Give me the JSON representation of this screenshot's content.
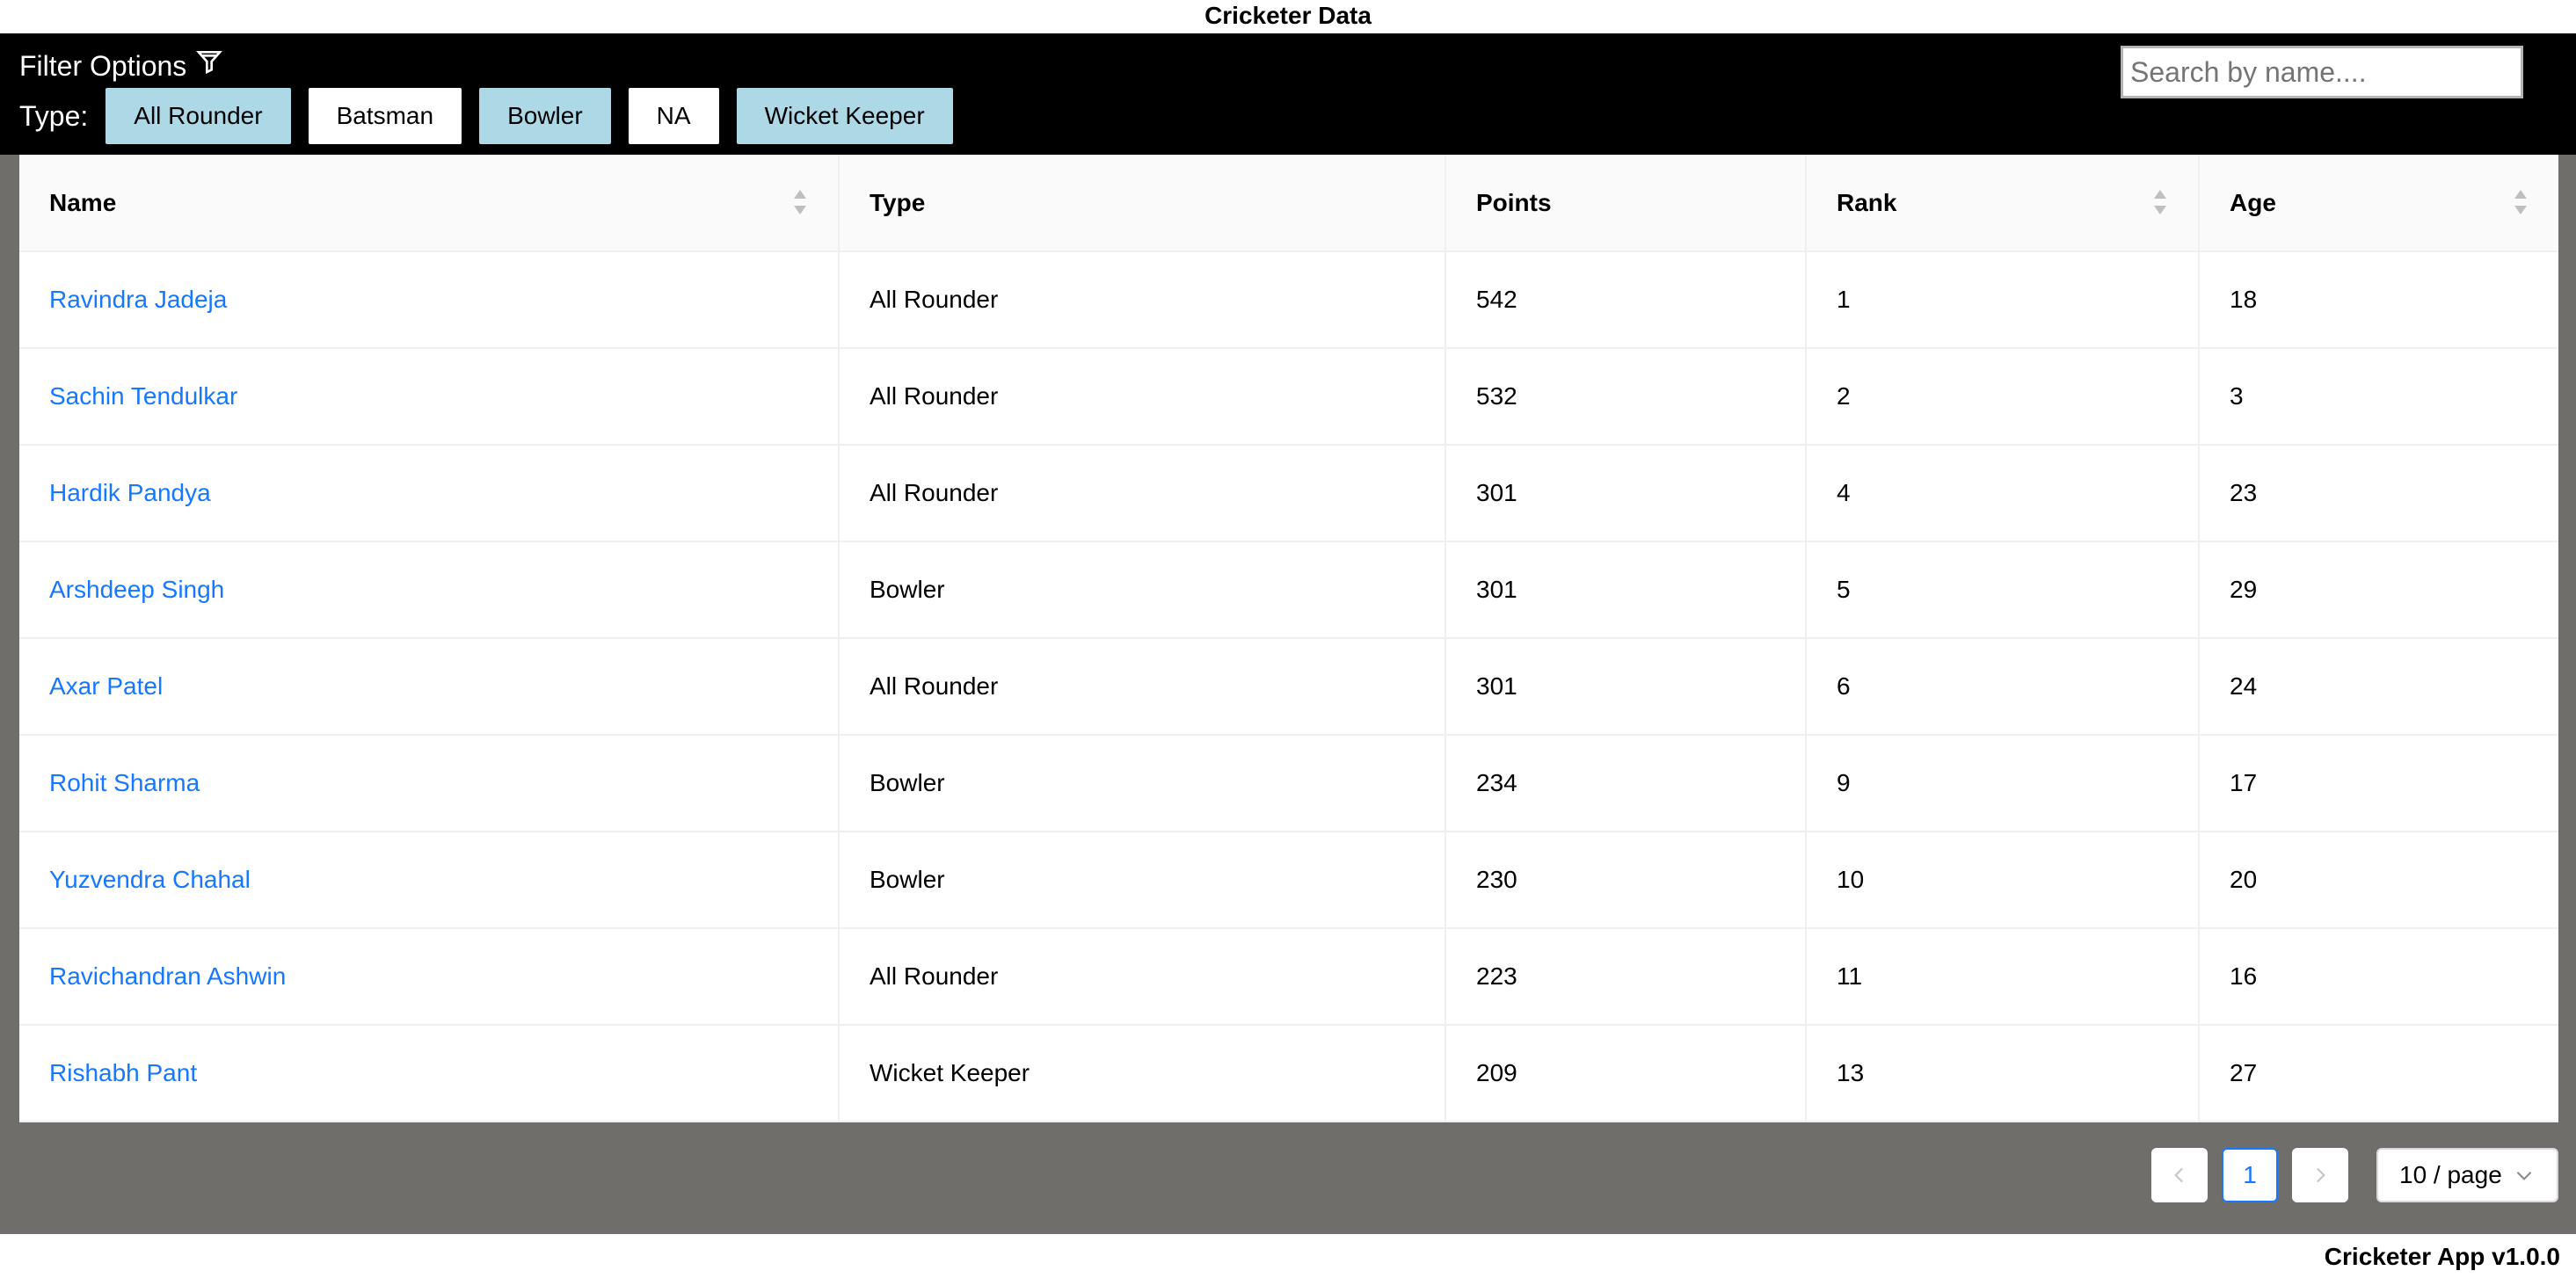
{
  "app_title": "Cricketer Data",
  "filter": {
    "title": "Filter Options",
    "type_label": "Type:",
    "chips": [
      {
        "label": "All Rounder",
        "selected": true
      },
      {
        "label": "Batsman",
        "selected": false
      },
      {
        "label": "Bowler",
        "selected": true
      },
      {
        "label": "NA",
        "selected": false
      },
      {
        "label": "Wicket Keeper",
        "selected": true
      }
    ],
    "selected_color": "#add8e6"
  },
  "search": {
    "placeholder": "Search by name....",
    "value": ""
  },
  "table": {
    "columns": [
      {
        "label": "Name",
        "sortable": true
      },
      {
        "label": "Type",
        "sortable": false
      },
      {
        "label": "Points",
        "sortable": false
      },
      {
        "label": "Rank",
        "sortable": true
      },
      {
        "label": "Age",
        "sortable": true
      }
    ],
    "rows": [
      {
        "name": "Ravindra Jadeja",
        "type": "All Rounder",
        "points": "542",
        "rank": "1",
        "age": "18"
      },
      {
        "name": "Sachin Tendulkar",
        "type": "All Rounder",
        "points": "532",
        "rank": "2",
        "age": "3"
      },
      {
        "name": "Hardik Pandya",
        "type": "All Rounder",
        "points": "301",
        "rank": "4",
        "age": "23"
      },
      {
        "name": "Arshdeep Singh",
        "type": "Bowler",
        "points": "301",
        "rank": "5",
        "age": "29"
      },
      {
        "name": "Axar Patel",
        "type": "All Rounder",
        "points": "301",
        "rank": "6",
        "age": "24"
      },
      {
        "name": "Rohit Sharma",
        "type": "Bowler",
        "points": "234",
        "rank": "9",
        "age": "17"
      },
      {
        "name": "Yuzvendra Chahal",
        "type": "Bowler",
        "points": "230",
        "rank": "10",
        "age": "20"
      },
      {
        "name": "Ravichandran Ashwin",
        "type": "All Rounder",
        "points": "223",
        "rank": "11",
        "age": "16"
      },
      {
        "name": "Rishabh Pant",
        "type": "Wicket Keeper",
        "points": "209",
        "rank": "13",
        "age": "27"
      }
    ],
    "link_color": "#1677ff"
  },
  "pagination": {
    "current_page": "1",
    "page_size": "10 / page"
  },
  "footer": {
    "version": "Cricketer App v1.0.0"
  },
  "icons": {
    "filter": "filter-icon",
    "prev": "chevron-left-icon",
    "next": "chevron-right-icon",
    "size_dropdown": "chevron-down-icon",
    "sort": "sort-icon"
  }
}
